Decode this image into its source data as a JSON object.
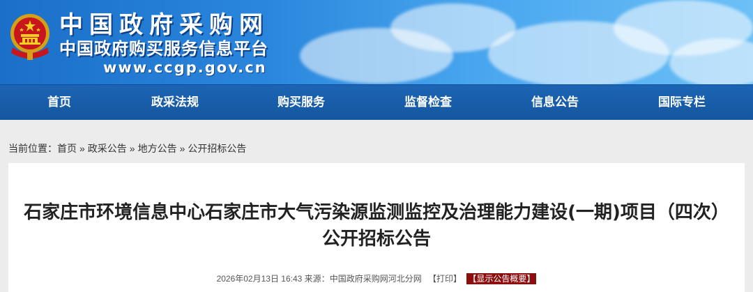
{
  "header": {
    "title": "中国政府采购网",
    "subtitle": "中国政府购买服务信息平台",
    "url": "www.ccgp.gov.cn"
  },
  "nav": {
    "items": [
      {
        "label": "首页"
      },
      {
        "label": "政采法规"
      },
      {
        "label": "购买服务"
      },
      {
        "label": "监督检查"
      },
      {
        "label": "信息公告"
      },
      {
        "label": "国际专栏"
      }
    ]
  },
  "breadcrumb": {
    "prefix": "当前位置：",
    "items": [
      "首页",
      "政采公告",
      "地方公告",
      "公开招标公告"
    ],
    "separator": "»"
  },
  "article": {
    "title": "石家庄市环境信息中心石家庄市大气污染源监测监控及治理能力建设(一期)项目（四次）公开招标公告",
    "date": "2026年02月13日 16:43",
    "source_label": "来源：",
    "source": "中国政府采购网河北分网",
    "print_label": "【打印】",
    "summary_label": "【显示公告概要】"
  },
  "colors": {
    "nav_bg": "#1b5fad",
    "summary_bg": "#8b0f0f",
    "page_bg": "#ececec"
  },
  "icons": {
    "emblem": "national-emblem-icon"
  }
}
